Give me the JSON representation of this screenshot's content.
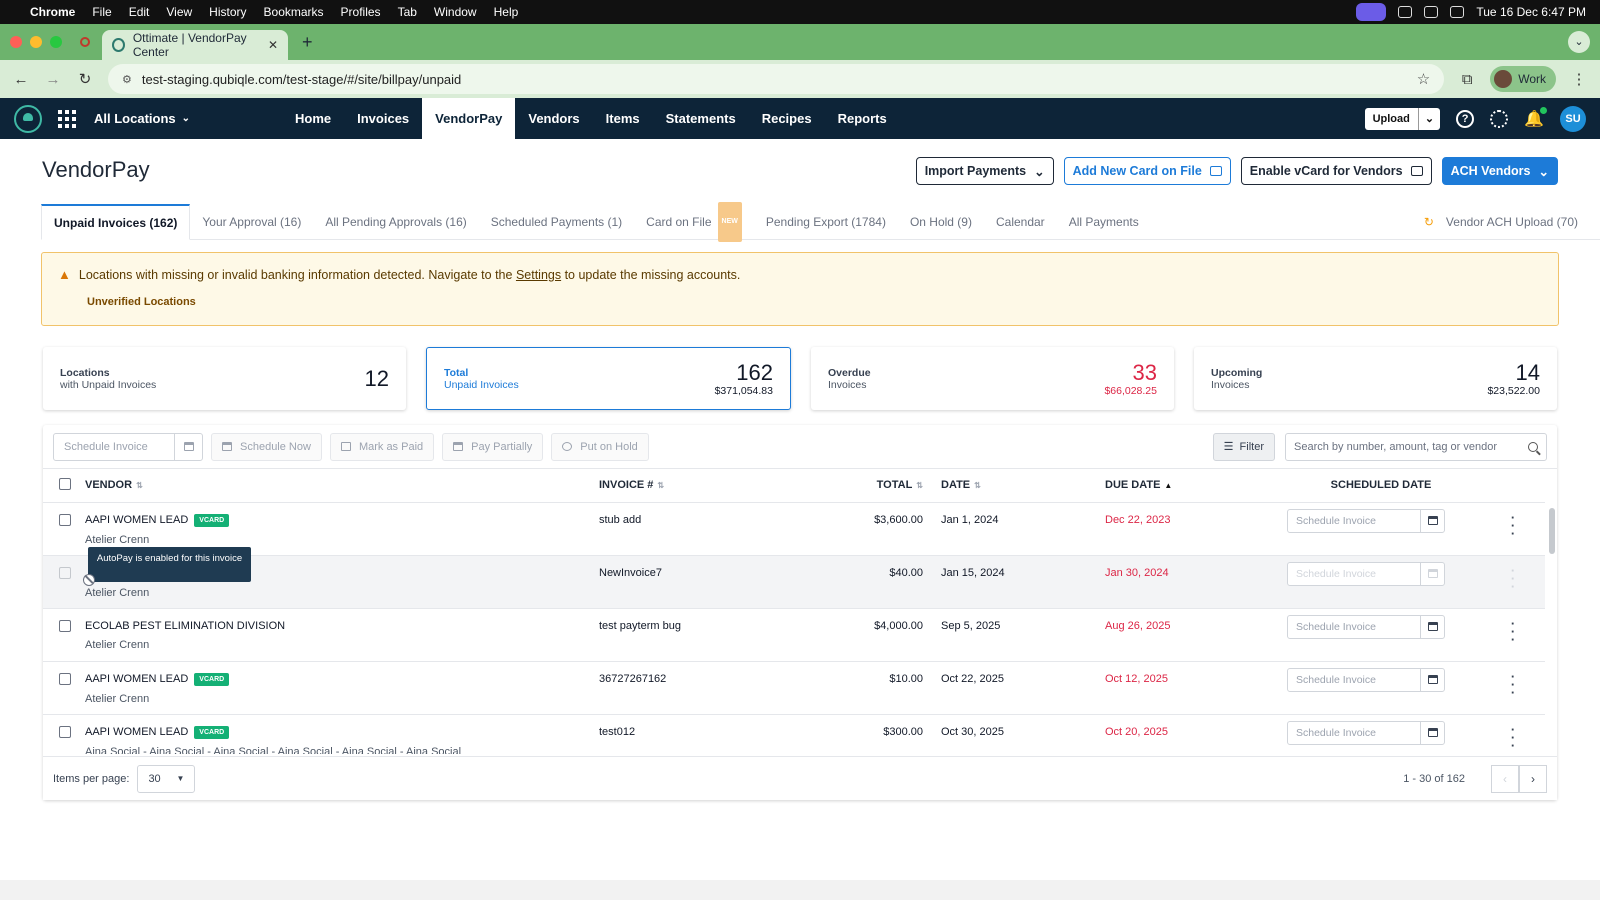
{
  "mac_menu": {
    "app": "Chrome",
    "items": [
      "File",
      "Edit",
      "View",
      "History",
      "Bookmarks",
      "Profiles",
      "Tab",
      "Window",
      "Help"
    ],
    "clock": "Tue 16 Dec  6:47 PM"
  },
  "browser": {
    "tab_title": "Ottimate | VendorPay Center",
    "url": "test-staging.qubiqle.com/test-stage/#/site/billpay/unpaid",
    "profile": "Work"
  },
  "app_nav": {
    "location_select": "All Locations",
    "links": [
      "Home",
      "Invoices",
      "VendorPay",
      "Vendors",
      "Items",
      "Statements",
      "Recipes",
      "Reports"
    ],
    "active_link": "VendorPay",
    "upload_label": "Upload",
    "user_initials": "SU"
  },
  "page": {
    "title": "VendorPay",
    "actions": {
      "import": "Import Payments",
      "add_card": "Add New Card on File",
      "enable_vcard": "Enable vCard for Vendors",
      "ach": "ACH Vendors"
    }
  },
  "tabs": [
    {
      "label": "Unpaid Invoices (162)"
    },
    {
      "label": "Your Approval (16)"
    },
    {
      "label": "All Pending Approvals (16)"
    },
    {
      "label": "Scheduled Payments (1)"
    },
    {
      "label": "Card on File",
      "badge": "NEW"
    },
    {
      "label": "Pending Export (1784)"
    },
    {
      "label": "On Hold (9)"
    },
    {
      "label": "Calendar"
    },
    {
      "label": "All Payments"
    }
  ],
  "tab_right": "Vendor ACH Upload (70)",
  "alert": {
    "before_link": "Locations with missing or invalid banking information detected. Navigate to the ",
    "link": "Settings",
    "after_link": " to update the missing accounts.",
    "sub": "Unverified Locations"
  },
  "stats": [
    {
      "title": "Locations",
      "subtitle": "with Unpaid Invoices",
      "count": "12",
      "amount": ""
    },
    {
      "title": "Total",
      "subtitle": "Unpaid Invoices",
      "count": "162",
      "amount": "$371,054.83"
    },
    {
      "title": "Overdue",
      "subtitle": "Invoices",
      "count": "33",
      "amount": "$66,028.25"
    },
    {
      "title": "Upcoming",
      "subtitle": "Invoices",
      "count": "14",
      "amount": "$23,522.00"
    }
  ],
  "toolbar": {
    "schedule_placeholder": "Schedule Invoice",
    "schedule_now": "Schedule Now",
    "mark_paid": "Mark as Paid",
    "pay_partially": "Pay Partially",
    "put_on_hold": "Put on Hold",
    "filter": "Filter",
    "search_placeholder": "Search by number, amount, tag or vendor"
  },
  "table": {
    "headers": {
      "vendor": "VENDOR",
      "invoice": "INVOICE #",
      "total": "TOTAL",
      "date": "DATE",
      "due_date": "DUE DATE",
      "scheduled": "SCHEDULED DATE"
    },
    "rows": [
      {
        "vendor": "AAPI WOMEN LEAD",
        "badge": "VCARD",
        "location": "Atelier Crenn",
        "invoice": "stub add",
        "total": "$3,600.00",
        "date": "Jan 1, 2024",
        "due": "Dec 22, 2023",
        "scheduled": "Schedule Invoice"
      },
      {
        "vendor": "",
        "badge": "",
        "location": "Atelier Crenn",
        "invoice": "NewInvoice7",
        "total": "$40.00",
        "date": "Jan 15, 2024",
        "due": "Jan 30, 2024",
        "scheduled": "Schedule Invoice"
      },
      {
        "vendor": "ECOLAB PEST ELIMINATION DIVISION",
        "badge": "",
        "location": "Atelier Crenn",
        "invoice": "test payterm bug",
        "total": "$4,000.00",
        "date": "Sep 5, 2025",
        "due": "Aug 26, 2025",
        "scheduled": "Schedule Invoice"
      },
      {
        "vendor": "AAPI WOMEN LEAD",
        "badge": "VCARD",
        "location": "Atelier Crenn",
        "invoice": "36727267162",
        "total": "$10.00",
        "date": "Oct 22, 2025",
        "due": "Oct 12, 2025",
        "scheduled": "Schedule Invoice"
      },
      {
        "vendor": "AAPI WOMEN LEAD",
        "badge": "VCARD",
        "location": "Aina Social - Aina Social - Aina Social - Aina Social - Aina Social - Aina Social",
        "invoice": "test012",
        "total": "$300.00",
        "date": "Oct 30, 2025",
        "due": "Oct 20, 2025",
        "scheduled": "Schedule Invoice"
      }
    ]
  },
  "tooltip": "AutoPay is enabled for this invoice",
  "pagination": {
    "items_per_page_label": "Items per page:",
    "items_per_page": "30",
    "range": "1 - 30 of 162"
  },
  "colors": {
    "nav_bg": "#0d2438",
    "accent": "#1d7bd8",
    "overdue": "#dc2646",
    "vcard_badge": "#14b075",
    "alert_bg": "#fef9e7"
  }
}
